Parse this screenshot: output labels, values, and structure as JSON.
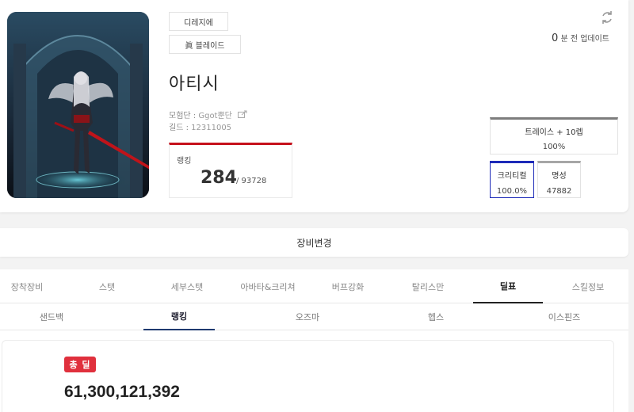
{
  "profile": {
    "server_tag": "디레지에",
    "class_tag": "眞 블레이드",
    "name": "아티시",
    "adventure_label": "모험단 :",
    "adventure_value": "Ggot뿐단",
    "guild_label": "길드 :",
    "guild_value": "12311005",
    "ranking_label": "랭킹",
    "ranking_value": "284",
    "ranking_total": "/ 93728",
    "updated_number": "0",
    "updated_text": "분 전 업데이트"
  },
  "buffs": {
    "trace_title": "트레이스 + 10렙",
    "trace_value": "100%",
    "critical_title": "크리티컬",
    "critical_value": "100.0%",
    "fame_title": "명성",
    "fame_value": "47882"
  },
  "equip_change_label": "장비변경",
  "main_tabs": [
    {
      "label": "장착장비",
      "active": false
    },
    {
      "label": "스탯",
      "active": false
    },
    {
      "label": "세부스탯",
      "active": false
    },
    {
      "label": "아바타&크리쳐",
      "active": false
    },
    {
      "label": "버프강화",
      "active": false
    },
    {
      "label": "탈리스만",
      "active": false
    },
    {
      "label": "딜표",
      "active": true
    },
    {
      "label": "스킬정보",
      "active": false
    }
  ],
  "sub_tabs": [
    {
      "label": "샌드백",
      "active": false
    },
    {
      "label": "랭킹",
      "active": true
    },
    {
      "label": "오즈마",
      "active": false
    },
    {
      "label": "헵스",
      "active": false
    },
    {
      "label": "이스핀즈",
      "active": false
    }
  ],
  "result": {
    "badge": "총 딜",
    "value": "61,300,121,392"
  },
  "colors": {
    "rank_accent": "#c6111c",
    "critical_accent": "#1d2ab8",
    "badge_red": "#e0303d"
  },
  "icons": {
    "refresh": "refresh-icon",
    "share": "share-icon"
  }
}
